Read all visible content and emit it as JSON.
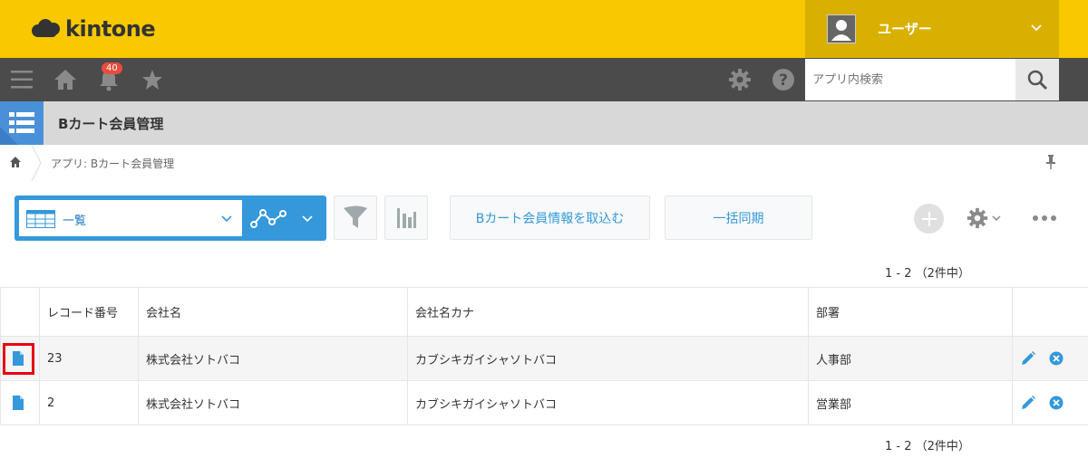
{
  "header": {
    "logo_text": "kintone",
    "user_name": "ユーザー",
    "brand_color": "#f8c800"
  },
  "nav": {
    "notification_count": "40",
    "search_placeholder": "アプリ内検索",
    "icons": [
      "menu-icon",
      "home-icon",
      "bell-icon",
      "star-icon",
      "gear-icon",
      "help-icon",
      "search-icon"
    ]
  },
  "app": {
    "title": "Bカート会員管理"
  },
  "breadcrumb": {
    "text": "アプリ: Bカート会員管理"
  },
  "toolbar": {
    "view_label": "一覧",
    "import_button": "Bカート会員情報を取込む",
    "sync_button": "一括同期"
  },
  "pager": {
    "top": "1 - 2 （2件中）",
    "bottom": "1 - 2 （2件中）"
  },
  "table": {
    "headers": [
      "",
      "レコード番号",
      "会社名",
      "会社名カナ",
      "部署",
      ""
    ],
    "rows": [
      {
        "record_no": "23",
        "company": "株式会社ソトバコ",
        "kana": "カブシキガイシャソトバコ",
        "dept": "人事部"
      },
      {
        "record_no": "2",
        "company": "株式会社ソトバコ",
        "kana": "カブシキガイシャソトバコ",
        "dept": "営業部"
      }
    ]
  },
  "colors": {
    "accent": "#3498db",
    "highlight": "#e60012"
  }
}
